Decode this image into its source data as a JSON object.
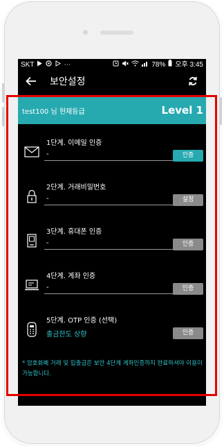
{
  "status_bar": {
    "carrier": "SKT",
    "extra": "⋯",
    "battery": "78%",
    "time": "오후 3:45"
  },
  "app_bar": {
    "title": "보안설정"
  },
  "level": {
    "user_text": "test100 님 현재등급",
    "level_text": "Level 1"
  },
  "steps": [
    {
      "icon": "envelope-icon",
      "label": "1단계. 이메일 인증",
      "value": "-",
      "button": "인증",
      "active": true
    },
    {
      "icon": "padlock-icon",
      "label": "2단계. 거래비밀번호",
      "value": "-",
      "button": "설정",
      "active": false
    },
    {
      "icon": "mobile-phone-icon",
      "label": "3단계. 휴대폰 인증",
      "value": "-",
      "button": "인증",
      "active": false
    },
    {
      "icon": "laptop-icon",
      "label": "4단계. 계좌 인증",
      "value": "-",
      "button": "인증",
      "active": false
    },
    {
      "icon": "otp-token-icon",
      "label": "5단계. OTP 인증 (선택)",
      "value": "출금한도 상향",
      "button": "인증",
      "active": false
    }
  ],
  "notice": "* 암호화폐 거래 및 입출금은 보안 4단계 계좌인증까지 완료하셔야 이용이 가능합니다.",
  "colors": {
    "accent": "#27a9b0",
    "annotation": "#e60000",
    "disabled_button": "#8a8a8a"
  }
}
